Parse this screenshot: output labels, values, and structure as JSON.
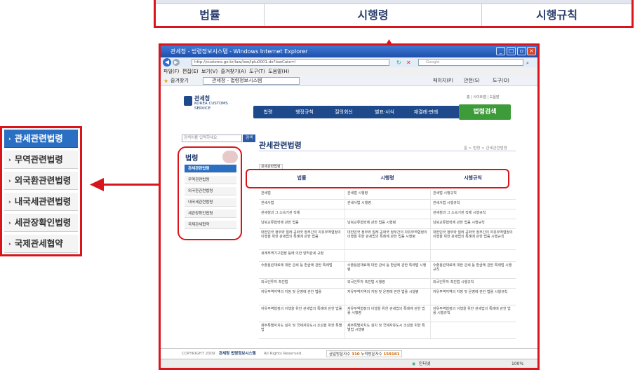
{
  "top_callout": {
    "col1": "법률",
    "col2": "시행령",
    "col3": "시행규칙"
  },
  "left_callout": {
    "items": [
      {
        "label": "관세관련법령",
        "active": true
      },
      {
        "label": "무역관련법령",
        "active": false
      },
      {
        "label": "외국환관련법령",
        "active": false
      },
      {
        "label": "내국세관련법령",
        "active": false
      },
      {
        "label": "세관장확인법령",
        "active": false
      },
      {
        "label": "국제관세협약",
        "active": false
      }
    ]
  },
  "browser": {
    "title": "관세청 - 법령정보시스템 - Windows Internet Explorer",
    "url": "http://customs.go.kr/law/law/lplu0001.do?lawCate=I",
    "search_placeholder": "Google",
    "menu": [
      "파일(F)",
      "편집(E)",
      "보기(V)",
      "즐겨찾기(A)",
      "도구(T)",
      "도움말(H)"
    ],
    "favorites_label": "즐겨찾기",
    "tab_label": "관세청 - 법령정보시스템",
    "tools": [
      "페이지(P)",
      "안전(S)",
      "도구(O)"
    ],
    "status_zone": "인터넷",
    "zoom": "100%"
  },
  "site": {
    "logo_name": "관세청",
    "logo_sub1": "KOREA CUSTOMS",
    "logo_sub2": "SERVICE",
    "util_links": "홈 | 사이트맵 | 도움말",
    "nav": [
      "법령",
      "행정규칙",
      "질의회신",
      "별표·서식",
      "재결례·판례"
    ],
    "nav_search": "법령검색",
    "sidebar_search_placeholder": "검색어를 입력하세요.",
    "sidebar_search_button": "검색",
    "sidebar_title": "법령",
    "sidebar_items": [
      {
        "label": "관세관련법령",
        "active": true
      },
      {
        "label": "무역관련법령",
        "active": false
      },
      {
        "label": "외국환관련법령",
        "active": false
      },
      {
        "label": "내국세관련법령",
        "active": false
      },
      {
        "label": "세관장확인법령",
        "active": false
      },
      {
        "label": "국제관세협약",
        "active": false
      }
    ],
    "page_title": "관세관련법령",
    "breadcrumb": "홈 > 법령 > 관세관련법령",
    "tab_chip": "관세관련법령",
    "law_header": [
      "법률",
      "시행령",
      "시행규칙"
    ],
    "law_rows": [
      [
        "관세법",
        "관세법 시행령",
        "관세법 시행규칙"
      ],
      [
        "관세사법",
        "관세사법 시행령",
        "관세사법 시행규칙"
      ],
      [
        "관세청과 그 소속기관 직제",
        "",
        "관세청과 그 소속기관 직제 시행규칙"
      ],
      [
        "남북교류협력에 관한 법률",
        "남북교류협력에 관한 법률 시행령",
        "남북교류협력에 관한 법률 시행규칙"
      ],
      [
        "대한민국 정부와 칠레 공화국 정부간의 자유무역협정의 이행을 위한 관세법의 특례에 관한 법률",
        "대한민국 정부와 칠레 공화국 정부간의 자유무역협정의 이행을 위한 관세법의 특례에 관한 법률 시행령",
        "대한민국 정부와 칠레 공화국 정부간의 자유무역협정의 이행을 위한 관세법의 특례에 관한 법률 시행규칙"
      ],
      [
        "세계무역기구협정 등에 의한 양허관세 규정",
        "",
        ""
      ],
      [
        "수출용원재료에 대한 관세 등 환급에 관한 특례법",
        "수출용원재료에 대한 관세 등 환급에 관한 특례법 시행령",
        "수출용원재료에 대한 관세 등 환급에 관한 특례법 시행규칙"
      ],
      [
        "외국인투자 촉진법",
        "외국인투자 촉진법 시행령",
        "외국인투자 촉진법 시행규칙"
      ],
      [
        "자유무역지역의 지정 및 운영에 관한 법률",
        "자유무역지역의 지정 및 운영에 관한 법률 시행령",
        "자유무역지역의 지정 및 운영에 관한 법률 시행규칙"
      ],
      [
        "자유무역협정의 이행을 위한 관세법의 특례에 관한 법률",
        "자유무역협정의 이행을 위한 관세법의 특례에 관한 법률 시행령",
        "자유무역협정의 이행을 위한 관세법의 특례에 관한 법률 시행규칙"
      ],
      [
        "제주특별자치도 설치 및 국제자유도시 조성을 위한 특별법",
        "제주특별자치도 설치 및 국제자유도시 조성을 위한 특별법 시행령",
        ""
      ]
    ],
    "footer_copyright": "COPYRIGHT 2009",
    "footer_org": "관세청 법령정보시스템",
    "footer_rights": "All Rights Reserved.",
    "footer_visits_label": "금일방문자수",
    "footer_visits_today": "310",
    "footer_total_label": "누적방문자수",
    "footer_visits_total": "159181"
  },
  "colors": {
    "highlight": "#d9151b",
    "active_blue": "#2b6fc2",
    "nav_blue": "#1e4a8c",
    "search_green": "#3e9b3a"
  }
}
